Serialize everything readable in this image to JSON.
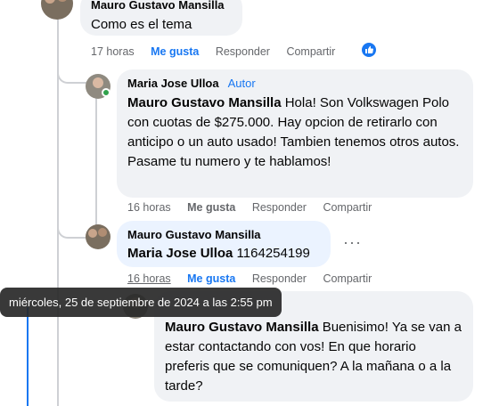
{
  "comments": [
    {
      "author": "Mauro Gustavo Mansilla",
      "text": "Como es el tema",
      "time": "17 horas",
      "like_label": "Me gusta",
      "reply_label": "Responder",
      "share_label": "Compartir",
      "reaction": "like-icon"
    },
    {
      "author": "Maria Jose Ulloa",
      "badge": "Autor",
      "mention": "Mauro Gustavo Mansilla",
      "text": " Hola! Son Volkswagen Polo con cuotas de $275.000. Hay opcion de retirarlo con anticipo o un auto usado! Tambien tenemos otros autos. Pasame tu numero y te hablamos!",
      "time": "16 horas",
      "like_label": "Me gusta",
      "reply_label": "Responder",
      "share_label": "Compartir"
    },
    {
      "author": "Mauro Gustavo Mansilla",
      "mention": "Maria Jose Ulloa",
      "text": " 1164254199",
      "time": "16 horas",
      "like_label": "Me gusta",
      "reply_label": "Responder",
      "share_label": "Compartir",
      "more_label": "···"
    },
    {
      "mention": "Mauro Gustavo Mansilla",
      "text": " Buenisimo! Ya se van a estar contactando con vos! En que horario preferis que se comuniquen? A la mañana o a la tarde?"
    }
  ],
  "tooltip": "miércoles, 25 de septiembre de 2024 a las 2:55 pm",
  "colors": {
    "accent": "#1877f2",
    "bubble": "#f0f2f5",
    "online": "#31a24c"
  }
}
